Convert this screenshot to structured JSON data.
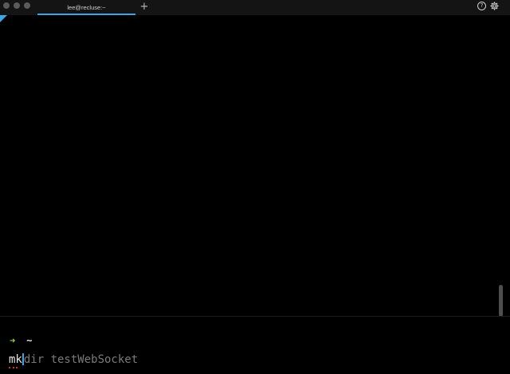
{
  "window": {
    "tab_title": "lee@recluse:~",
    "new_tab_label": "+",
    "help_label": "?",
    "icons": {
      "close": "close-dot-icon",
      "minimize": "minimize-dot-icon",
      "maximize": "maximize-dot-icon",
      "help": "help-circle-icon",
      "settings": "gear-icon"
    },
    "accent_color": "#3ea6e6"
  },
  "terminal": {
    "prompt_arrow": "➜",
    "prompt_dir": "~",
    "typed_text": "mk",
    "suggestion_text": "dir testWebSocket",
    "prompt_arrow_color": "#9ad039",
    "suggestion_color": "#7a7a7a"
  }
}
